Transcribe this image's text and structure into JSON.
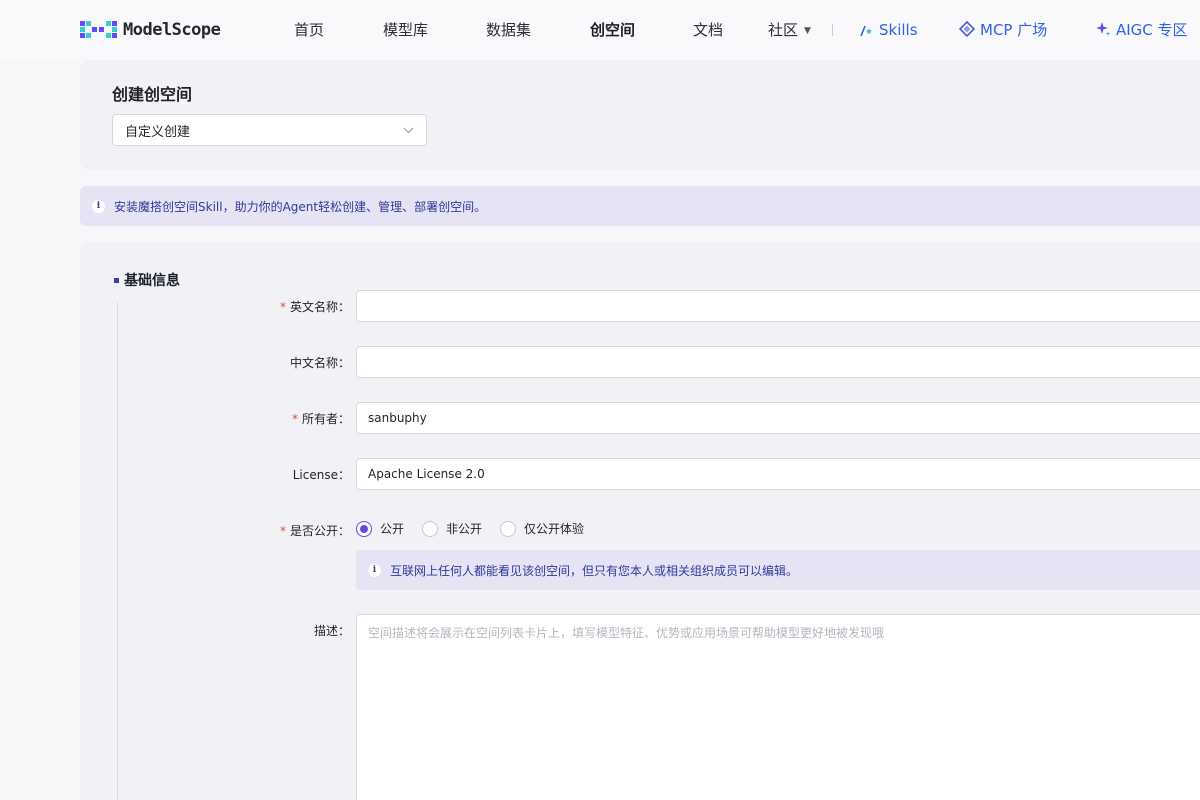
{
  "header": {
    "brand": "ModelScope",
    "nav": [
      {
        "label": "首页"
      },
      {
        "label": "模型库"
      },
      {
        "label": "数据集"
      },
      {
        "label": "创空间"
      },
      {
        "label": "文档"
      },
      {
        "label": "社区"
      }
    ],
    "ext": [
      {
        "label": "Skills",
        "icon": "skills-icon"
      },
      {
        "label": "MCP 广场",
        "icon": "mcp-icon"
      },
      {
        "label": "AIGC 专区",
        "icon": "sparkle-icon"
      }
    ],
    "active": "创空间"
  },
  "create": {
    "title": "创建创空间",
    "mode_value": "自定义创建"
  },
  "banner": {
    "text": "安装魔搭创空间Skill，助力你的Agent轻松创建、管理、部署创空间。"
  },
  "form": {
    "section_title": "基础信息",
    "english_name": {
      "label": "英文名称",
      "value": ""
    },
    "chinese_name": {
      "label": "中文名称",
      "value": ""
    },
    "owner": {
      "label": "所有者",
      "value": "sanbuphy"
    },
    "license": {
      "label": "License",
      "value": "Apache License 2.0"
    },
    "visibility": {
      "label": "是否公开",
      "options": [
        "公开",
        "非公开",
        "仅公开体验"
      ],
      "selected": "公开",
      "hint": "互联网上任何人都能看见该创空间，但只有您本人或相关组织成员可以编辑。"
    },
    "description": {
      "label": "描述",
      "placeholder": "空间描述将会展示在空间列表卡片上，填写模型特征、优势或应用场景可帮助模型更好地被发现哦"
    }
  },
  "colors": {
    "accent": "#5b4ce6",
    "link": "#2f62e8",
    "required": "#e8453c",
    "info_bg": "#e6e3f4"
  }
}
